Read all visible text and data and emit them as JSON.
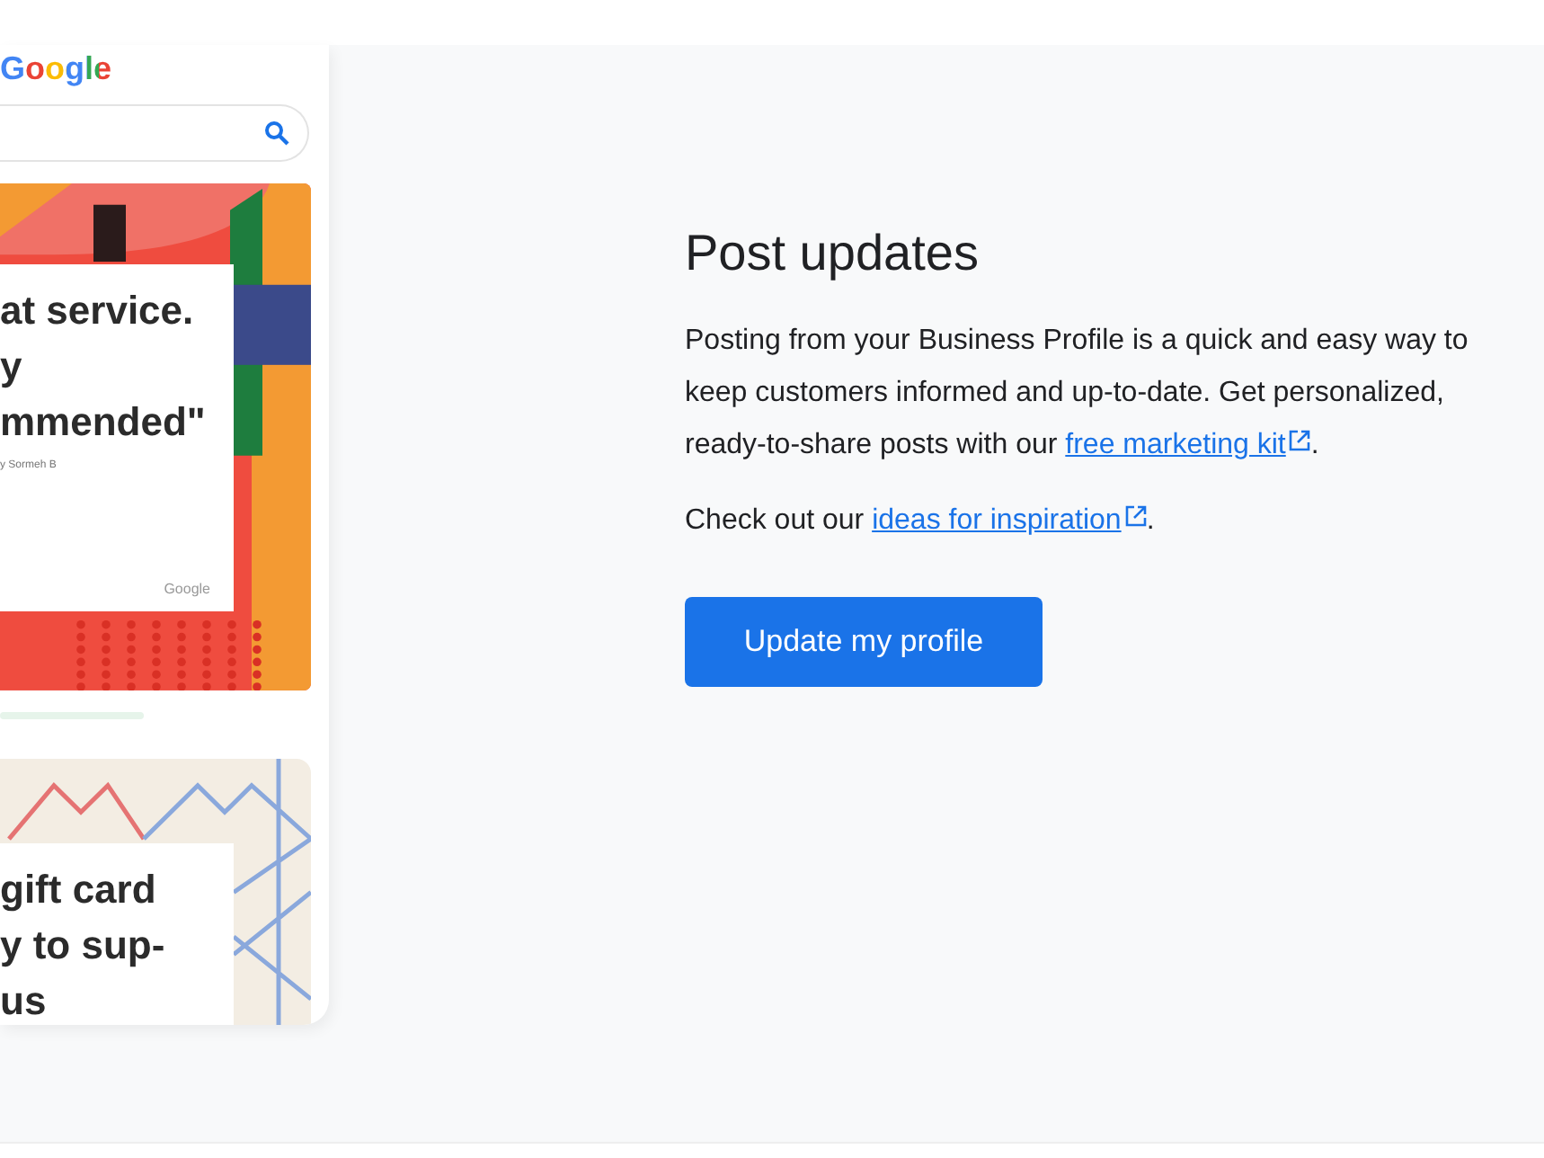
{
  "phone": {
    "logo": "Google",
    "cards": [
      {
        "kind": "review",
        "quote": "at service.\ny\nmmended\"",
        "attribution": "y Sormeh B",
        "brand": "Google"
      },
      {
        "kind": "gift",
        "quote": "gift card\ny to sup-\nus"
      }
    ]
  },
  "content": {
    "title": "Post updates",
    "paragraphs": [
      {
        "text": "Posting from your Business Profile is a quick and easy way to keep customers informed and up-to-date. Get personalized, ready-to-share posts with our ",
        "link": "free marketing kit",
        "after": "."
      },
      {
        "text": "Check out our ",
        "link": "ideas for inspiration",
        "after": "."
      }
    ],
    "button": "Update my profile"
  }
}
